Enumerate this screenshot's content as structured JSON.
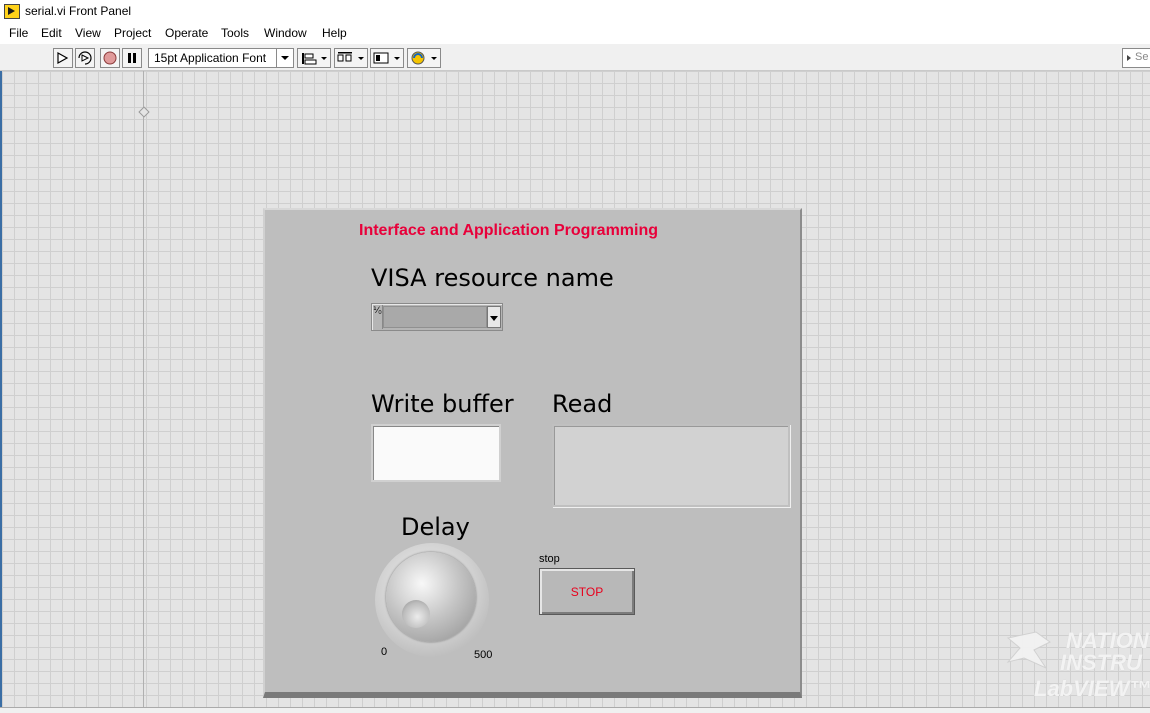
{
  "window": {
    "title": "serial.vi Front Panel"
  },
  "menu": [
    "File",
    "Edit",
    "View",
    "Project",
    "Operate",
    "Tools",
    "Window",
    "Help"
  ],
  "toolbar": {
    "font": "15pt Application Font",
    "search_placeholder": "Se"
  },
  "panel": {
    "title": "Interface and Application Programming",
    "visa_label": "VISA resource name",
    "visa_icon": "⅟₀",
    "write_label": "Write buffer",
    "write_value": "",
    "read_label": "Read",
    "read_value": "",
    "delay_label": "Delay",
    "delay_min": "0",
    "delay_max": "500",
    "stop_label": "stop",
    "stop_button": "STOP"
  },
  "watermark": {
    "line1": "NATION",
    "line2": "INSTRU",
    "line3": "LabVIEW™ E"
  },
  "colors": {
    "title": "#e8003a",
    "stop": "#e8001c",
    "panel": "#bebebe"
  }
}
